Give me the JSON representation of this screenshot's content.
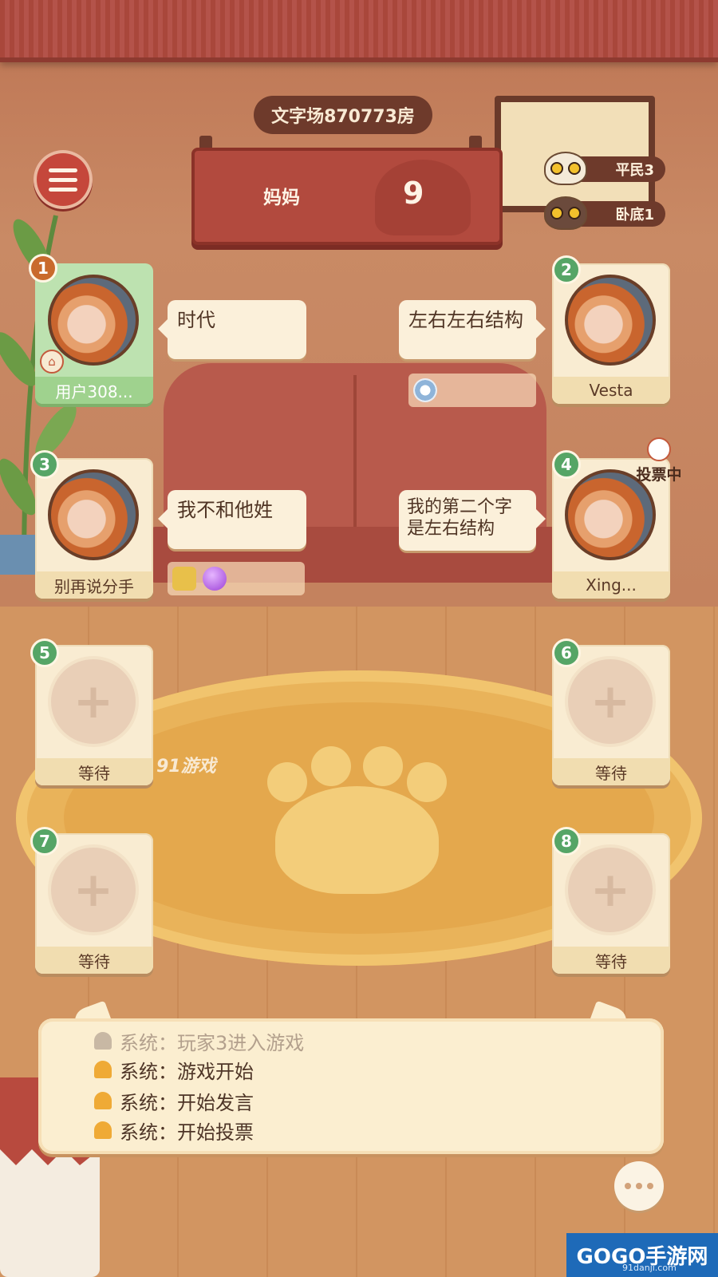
{
  "room": {
    "title": "文字场870773房"
  },
  "board": {
    "word": "妈妈",
    "count": "9"
  },
  "roles": [
    {
      "label": "平民3",
      "cat": "white-cat-icon"
    },
    {
      "label": "卧底1",
      "cat": "dark-cat-icon"
    }
  ],
  "players": [
    {
      "seat": "1",
      "name": "用户308...",
      "is_self": true,
      "avatar": "woman-portrait",
      "speech": "时代"
    },
    {
      "seat": "2",
      "name": "Vesta",
      "avatar": "woman-portrait",
      "speech": "左右左右结构"
    },
    {
      "seat": "3",
      "name": "别再说分手",
      "avatar": "woman-portrait",
      "speech": "我不和他姓"
    },
    {
      "seat": "4",
      "name": "Xing...",
      "avatar": "woman-portrait",
      "speech": "我的第二个字是左右结构",
      "status": "投票中"
    },
    {
      "seat": "5",
      "name": "等待"
    },
    {
      "seat": "6",
      "name": "等待"
    },
    {
      "seat": "7",
      "name": "等待"
    },
    {
      "seat": "8",
      "name": "等待"
    }
  ],
  "gifts": {
    "player2": [
      "spinner-gift-icon"
    ],
    "player3": [
      "cube-gift-icon",
      "gem-gift-icon"
    ]
  },
  "watermark": "91游戏",
  "system_log": [
    {
      "text": "系统：玩家3进入游戏",
      "faded": true
    },
    {
      "text": "系统：游戏开始"
    },
    {
      "text": "系统：开始发言"
    },
    {
      "text": "系统：开始投票"
    }
  ],
  "brand": {
    "name": "GOGO手游网",
    "url": "91danji.com"
  },
  "colors": {
    "accent_red": "#b24a3e",
    "self_green": "#bde2b0",
    "seat_green": "#56a566",
    "card_cream": "#f9ecd2"
  }
}
